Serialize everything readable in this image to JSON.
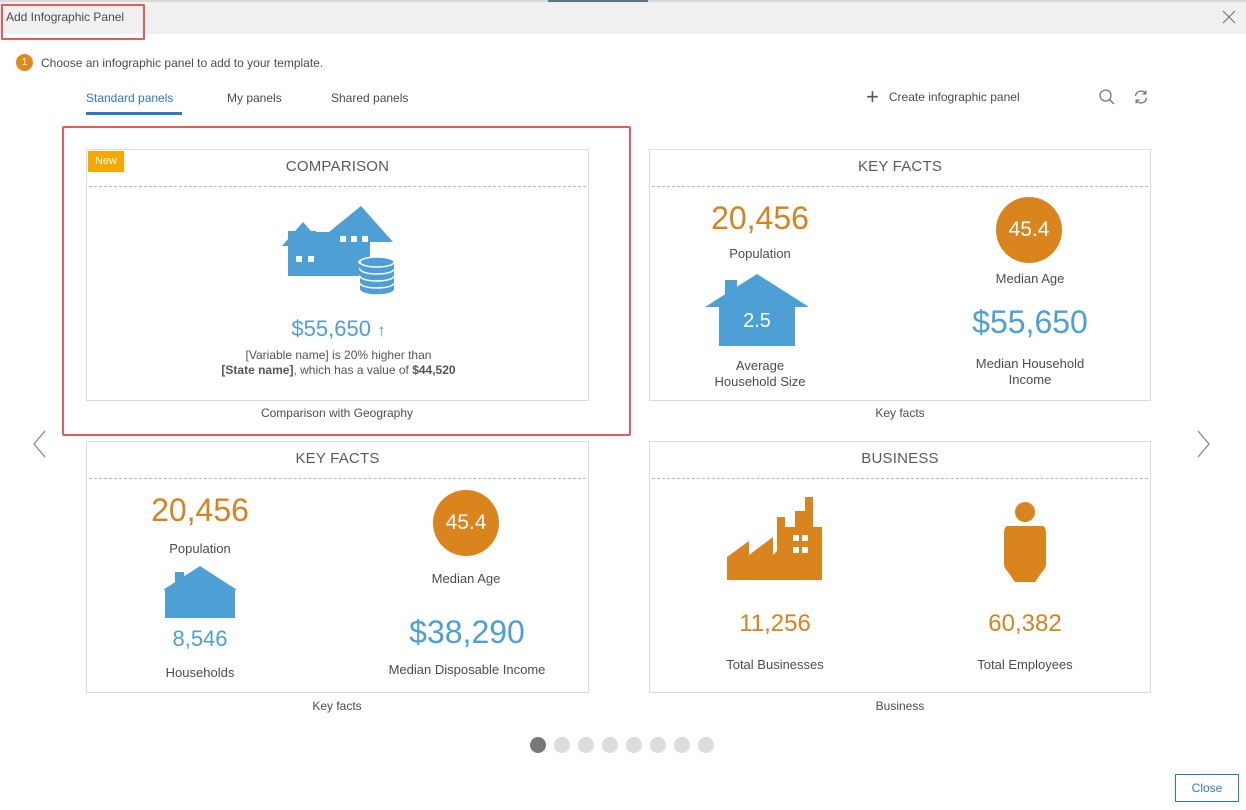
{
  "dialog": {
    "title": "Add Infographic Panel"
  },
  "step": {
    "number": "1",
    "text": "Choose an infographic panel to add to your template."
  },
  "tabs": [
    {
      "label": "Standard panels",
      "active": true
    },
    {
      "label": "My panels",
      "active": false
    },
    {
      "label": "Shared panels",
      "active": false
    }
  ],
  "toolbar": {
    "create_label": "Create infographic panel"
  },
  "cards": {
    "comparison": {
      "badge": "New",
      "title": "COMPARISON",
      "value": "$55,650",
      "arrow": "↑",
      "line1": "[Variable name] is 20% higher than",
      "line2_bold": "[State name]",
      "line2_rest": ", which has a value of ",
      "line2_value": "$44,520",
      "caption": "Comparison with Geography"
    },
    "keyfacts1": {
      "title": "KEY FACTS",
      "population_value": "20,456",
      "population_label": "Population",
      "age_value": "45.4",
      "age_label": "Median Age",
      "household_value": "2.5",
      "household_label_1": "Average",
      "household_label_2": "Household Size",
      "income_value": "$55,650",
      "income_label_1": "Median Household",
      "income_label_2": "Income",
      "caption": "Key facts"
    },
    "keyfacts2": {
      "title": "KEY FACTS",
      "population_value": "20,456",
      "population_label": "Population",
      "age_value": "45.4",
      "age_label": "Median Age",
      "households_value": "8,546",
      "households_label": "Households",
      "income_value": "$38,290",
      "income_label": "Median Disposable Income",
      "caption": "Key facts"
    },
    "business": {
      "title": "BUSINESS",
      "businesses_value": "11,256",
      "businesses_label": "Total Businesses",
      "employees_value": "60,382",
      "employees_label": "Total Employees",
      "caption": "Business"
    }
  },
  "pagination": {
    "pages": 8,
    "current": 1
  },
  "footer": {
    "close_label": "Close"
  },
  "colors": {
    "accent_blue": "#2c7ac2",
    "orange": "#d9841c",
    "light_blue": "#4d9fd6",
    "highlight_red": "#e35a5a",
    "badge_yellow": "#f5a800"
  }
}
